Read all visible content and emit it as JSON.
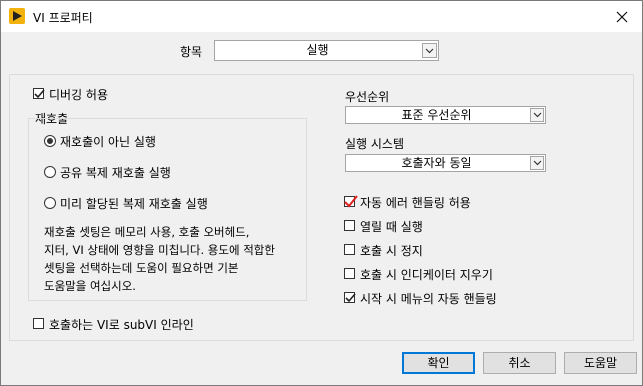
{
  "window": {
    "title": "VI 프로퍼티"
  },
  "category": {
    "label": "항목",
    "value": "실행"
  },
  "left": {
    "allow_debugging": {
      "label": "디버깅 허용",
      "checked": true
    },
    "reentrancy": {
      "legend": "재호출",
      "options": [
        {
          "label": "재호출이 아닌 실행",
          "selected": true
        },
        {
          "label": "공유 복제 재호출 실행",
          "selected": false
        },
        {
          "label": "미리 할당된 복제 재호출 실행",
          "selected": false
        }
      ],
      "description": [
        "재호출 셋팅은 메모리 사용, 호출 오버헤드,",
        "지터, VI 상태에 영향을 미칩니다. 용도에 적합한",
        "셋팅을 선택하는데 도움이 필요하면 기본",
        "도움말을 여십시오."
      ]
    },
    "inline_subvi": {
      "label": "호출하는 VI로 subVI 인라인",
      "checked": false
    }
  },
  "right": {
    "priority": {
      "label": "우선순위",
      "value": "표준 우선순위"
    },
    "exec_system": {
      "label": "실행 시스템",
      "value": "호출자와 동일"
    },
    "checks": [
      {
        "label": "자동 에러 핸들링 허용",
        "checked": true
      },
      {
        "label": "열릴 때 실행",
        "checked": false
      },
      {
        "label": "호출 시 정지",
        "checked": false
      },
      {
        "label": "호출 시 인디케이터 지우기",
        "checked": false
      },
      {
        "label": "시작 시 메뉴의 자동 핸들링",
        "checked": true
      }
    ]
  },
  "buttons": {
    "ok": "확인",
    "cancel": "취소",
    "help": "도움말"
  },
  "colors": {
    "accent": "#0078d7",
    "check_red": "#e02020"
  }
}
